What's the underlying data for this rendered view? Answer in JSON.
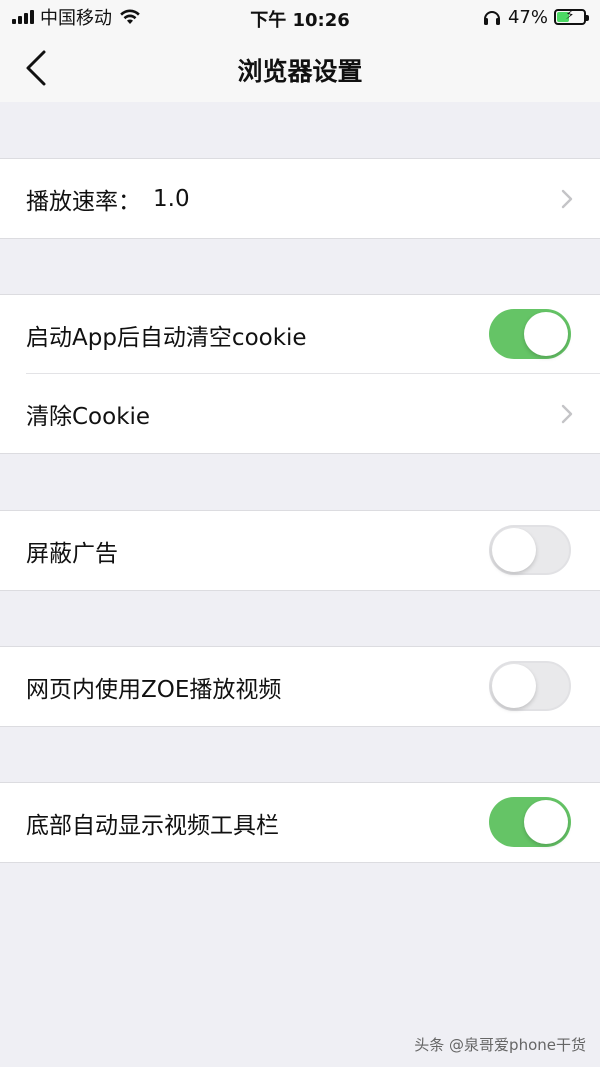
{
  "status_bar": {
    "carrier": "中国移动",
    "time": "下午 10:26",
    "battery_percent": "47%",
    "battery_level": 0.47,
    "icons": [
      "signal-icon",
      "wifi-icon",
      "headphones-icon",
      "battery-icon",
      "charging-icon"
    ]
  },
  "nav": {
    "title": "浏览器设置",
    "back_icon": "chevron-left-icon"
  },
  "settings": {
    "playback_rate": {
      "label": "播放速率：",
      "value": "1.0"
    },
    "auto_clear_cookie": {
      "label": "启动App后自动清空cookie",
      "enabled": true
    },
    "clear_cookie": {
      "label": "清除Cookie"
    },
    "block_ads": {
      "label": "屏蔽广告",
      "enabled": false
    },
    "zoe_player": {
      "label": "网页内使用ZOE播放视频",
      "enabled": false
    },
    "video_toolbar": {
      "label": "底部自动显示视频工具栏",
      "enabled": true
    }
  },
  "colors": {
    "toggle_on": "#65c466",
    "toggle_off": "#e9e9eb",
    "background": "#efeff4"
  },
  "watermark": "头条 @泉哥爱phone干货"
}
